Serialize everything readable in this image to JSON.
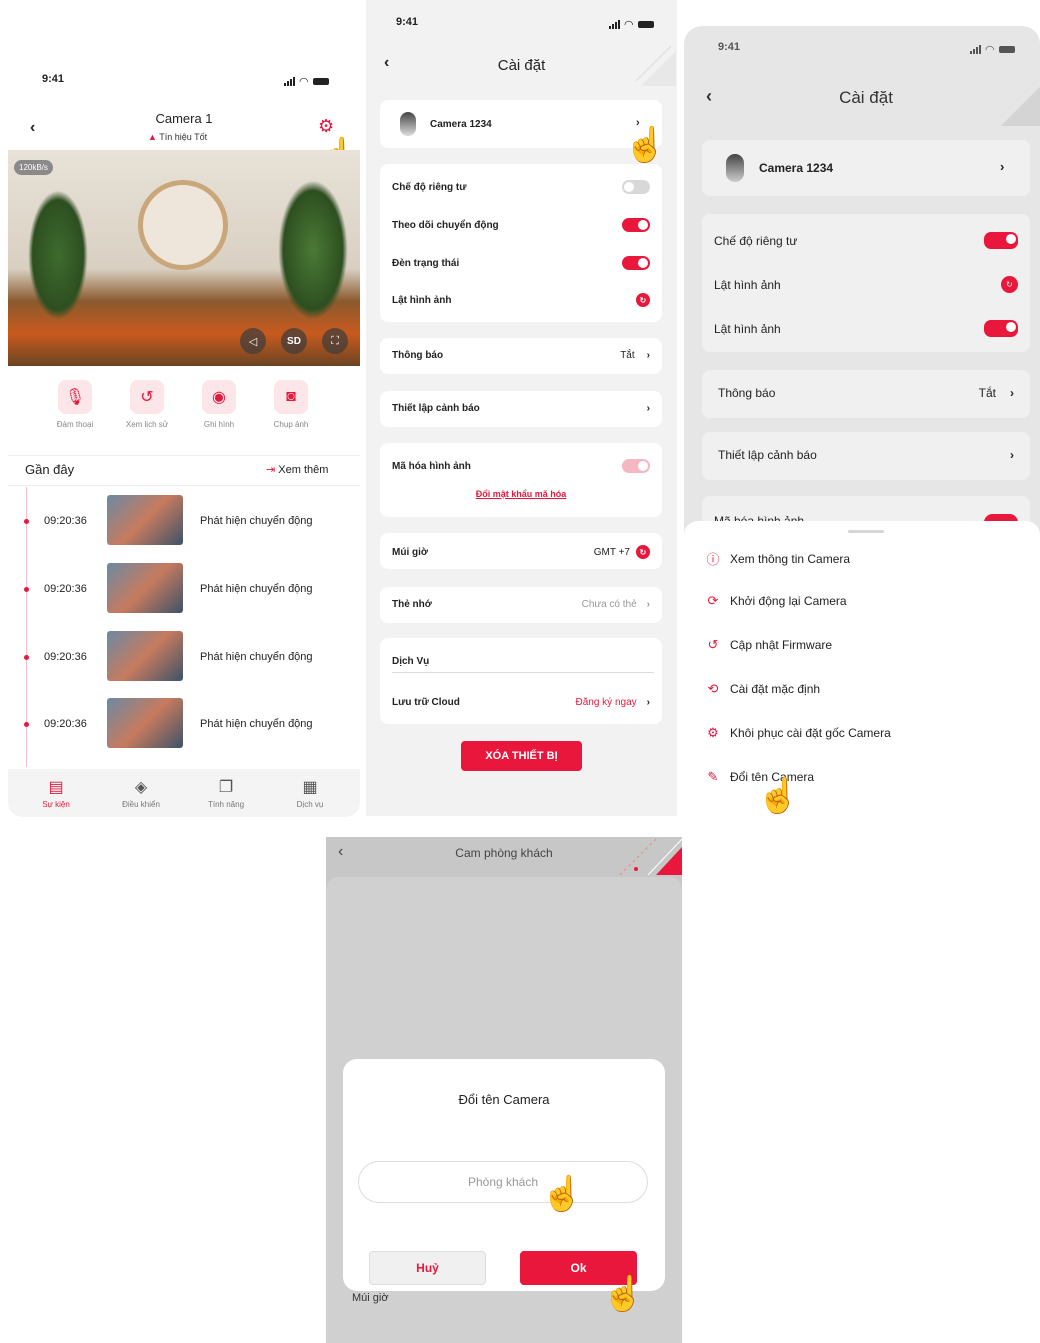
{
  "status_time": "9:41",
  "screen1": {
    "title": "Camera 1",
    "signal": "Tín hiệu Tốt",
    "speed": "120kB/s",
    "sd": "SD",
    "actions": [
      "Đàm thoại",
      "Xem lịch sử",
      "Ghi hình",
      "Chụp ảnh"
    ],
    "recent": "Gần đây",
    "see_more": "Xem thêm",
    "events": [
      {
        "time": "09:20:36",
        "label": "Phát hiện chuyển động"
      },
      {
        "time": "09:20:36",
        "label": "Phát hiện chuyển động"
      },
      {
        "time": "09:20:36",
        "label": "Phát hiện chuyển động"
      },
      {
        "time": "09:20:36",
        "label": "Phát hiện chuyển động"
      }
    ],
    "tabs": [
      "Sự kiện",
      "Điều khiển",
      "Tính năng",
      "Dịch vụ"
    ]
  },
  "screen2": {
    "title": "Cài đặt",
    "camera": "Camera 1234",
    "privacy": "Chế độ riêng tư",
    "motion": "Theo dõi chuyển động",
    "led": "Đèn trạng thái",
    "flip": "Lật hình ảnh",
    "notify": "Thông báo",
    "notify_value": "Tắt",
    "alarm": "Thiết lập cảnh báo",
    "encrypt": "Mã hóa hình ảnh",
    "change_pw": "Đổi mật khẩu mã hóa",
    "timezone": "Múi giờ",
    "timezone_value": "GMT +7",
    "memory": "Thẻ nhớ",
    "memory_value": "Chưa có thẻ",
    "service": "Dịch Vụ",
    "cloud": "Lưu trữ Cloud",
    "cloud_value": "Đăng ký ngay",
    "delete": "XÓA THIẾT BỊ"
  },
  "screen3": {
    "title": "Cài đặt",
    "camera": "Camera 1234",
    "privacy": "Chế độ riêng tư",
    "flip1": "Lật hình ảnh",
    "flip2": "Lật hình ảnh",
    "notify": "Thông báo",
    "notify_value": "Tắt",
    "alarm": "Thiết lập cảnh báo",
    "partial": "Mã hóa hình ảnh",
    "menu": [
      "Xem thông tin Camera",
      "Khởi động lại Camera",
      "Cập nhật Firmware",
      "Cài đặt mặc định",
      "Khôi phục cài đặt gốc Camera",
      "Đổi tên Camera"
    ]
  },
  "screen4": {
    "title": "Cam phòng khách",
    "dialog_title": "Đổi tên Camera",
    "placeholder": "Phòng khách",
    "cancel": "Huỷ",
    "ok": "Ok",
    "behind": "Múi giờ"
  },
  "colors": {
    "accent": "#e8173b",
    "gray_bg": "#ececec"
  }
}
